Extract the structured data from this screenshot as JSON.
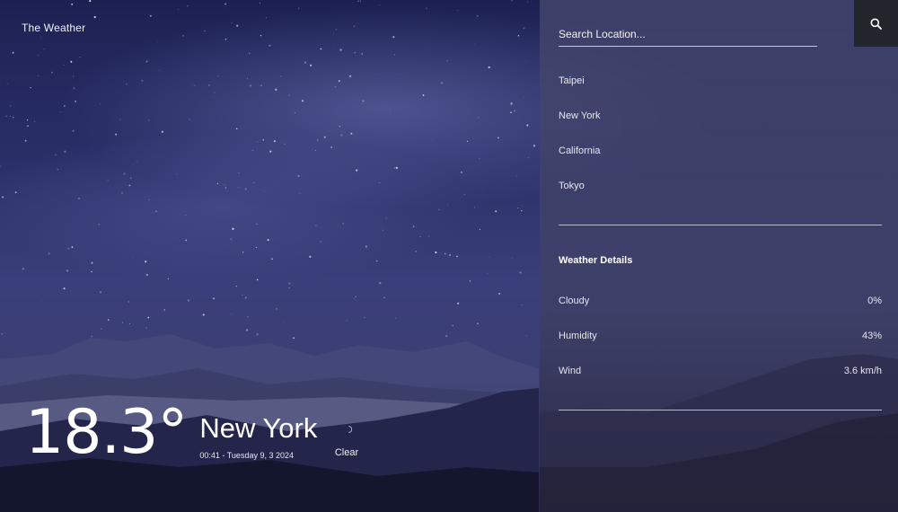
{
  "app": {
    "brand": "The Weather"
  },
  "current": {
    "temperature": "18.3°",
    "city": "New York",
    "datetime": "00:41 - Tuesday 9, 3 2024",
    "condition": "Clear",
    "condition_icon": "moon-icon"
  },
  "search": {
    "placeholder": "Search Location...",
    "value": "",
    "icon": "search-icon"
  },
  "locations": [
    "Taipei",
    "New York",
    "California",
    "Tokyo"
  ],
  "details": {
    "title": "Weather Details",
    "rows": [
      {
        "label": "Cloudy",
        "value": "0%"
      },
      {
        "label": "Humidity",
        "value": "43%"
      },
      {
        "label": "Wind",
        "value": "3.6 km/h"
      }
    ]
  },
  "colors": {
    "sky_top": "#1d2152",
    "sky_mid": "#3a3e7a",
    "panel": "#464870",
    "search_button": "#23252d"
  }
}
